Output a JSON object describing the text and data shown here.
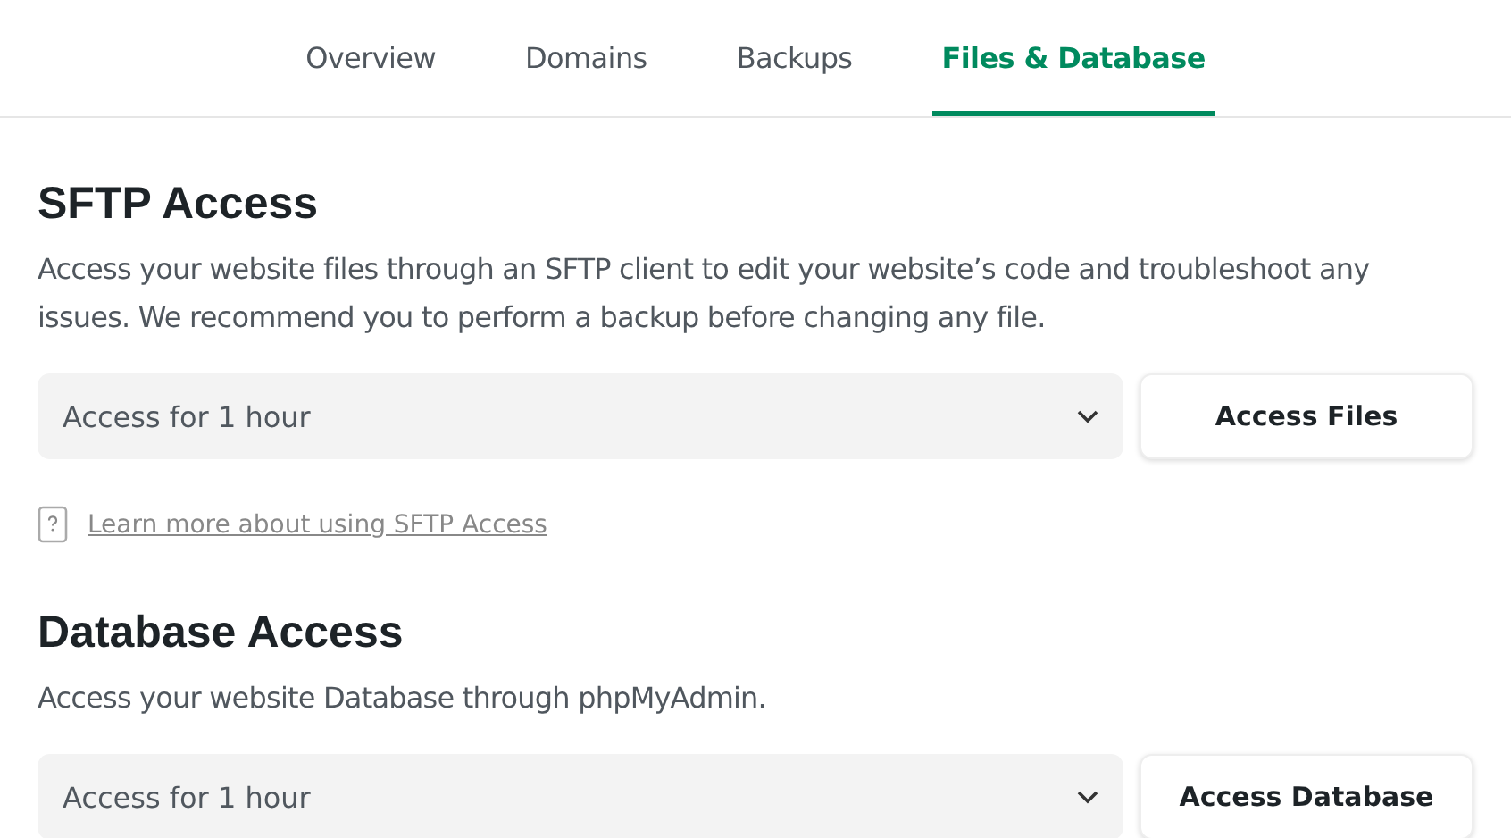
{
  "tabs": [
    {
      "label": "Overview",
      "selected": false
    },
    {
      "label": "Domains",
      "selected": false
    },
    {
      "label": "Backups",
      "selected": false
    },
    {
      "label": "Files & Database",
      "selected": true
    }
  ],
  "sections": [
    {
      "title": "SFTP Access",
      "description": "Access your website files through an SFTP client to edit your website’s code and troubleshoot any issues. We recommend you to perform a backup before changing any file.",
      "select_value": "Access for 1 hour",
      "button": "Access Files",
      "help_link": "Learn more about using SFTP Access"
    },
    {
      "title": "Database Access",
      "description": "Access your website Database through phpMyAdmin.",
      "select_value": "Access for 1 hour",
      "button": "Access Database"
    }
  ]
}
